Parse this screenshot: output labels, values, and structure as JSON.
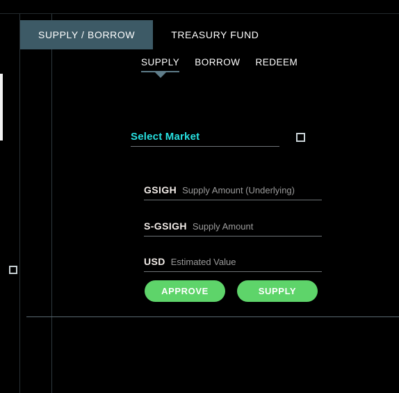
{
  "theme": {
    "background": "#000000",
    "active_tab_bg": "#3d5a66",
    "accent_cyan": "#27e0e0",
    "button_green": "#5ed46a",
    "underline_gray": "#6f7579",
    "divider_gray": "#5a6a72"
  },
  "main_tabs": [
    {
      "label": "SUPPLY / BORROW",
      "active": true
    },
    {
      "label": "TREASURY FUND",
      "active": false
    }
  ],
  "sub_tabs": [
    {
      "label": "SUPPLY",
      "active": true
    },
    {
      "label": "BORROW",
      "active": false
    },
    {
      "label": "REDEEM",
      "active": false
    }
  ],
  "form": {
    "select_market": {
      "label": "Select Market",
      "value": "",
      "icon": "broken-image-placeholder-icon"
    },
    "fields": [
      {
        "unit": "GSIGH",
        "placeholder": "Supply Amount (Underlying)",
        "value": ""
      },
      {
        "unit": "S-GSIGH",
        "placeholder": "Supply Amount",
        "value": ""
      },
      {
        "unit": "USD",
        "placeholder": "Estimated Value",
        "value": ""
      }
    ],
    "buttons": [
      {
        "label": "APPROVE"
      },
      {
        "label": "SUPPLY"
      }
    ]
  },
  "gutter": {
    "placeholder_icon": "broken-image-placeholder-icon"
  }
}
